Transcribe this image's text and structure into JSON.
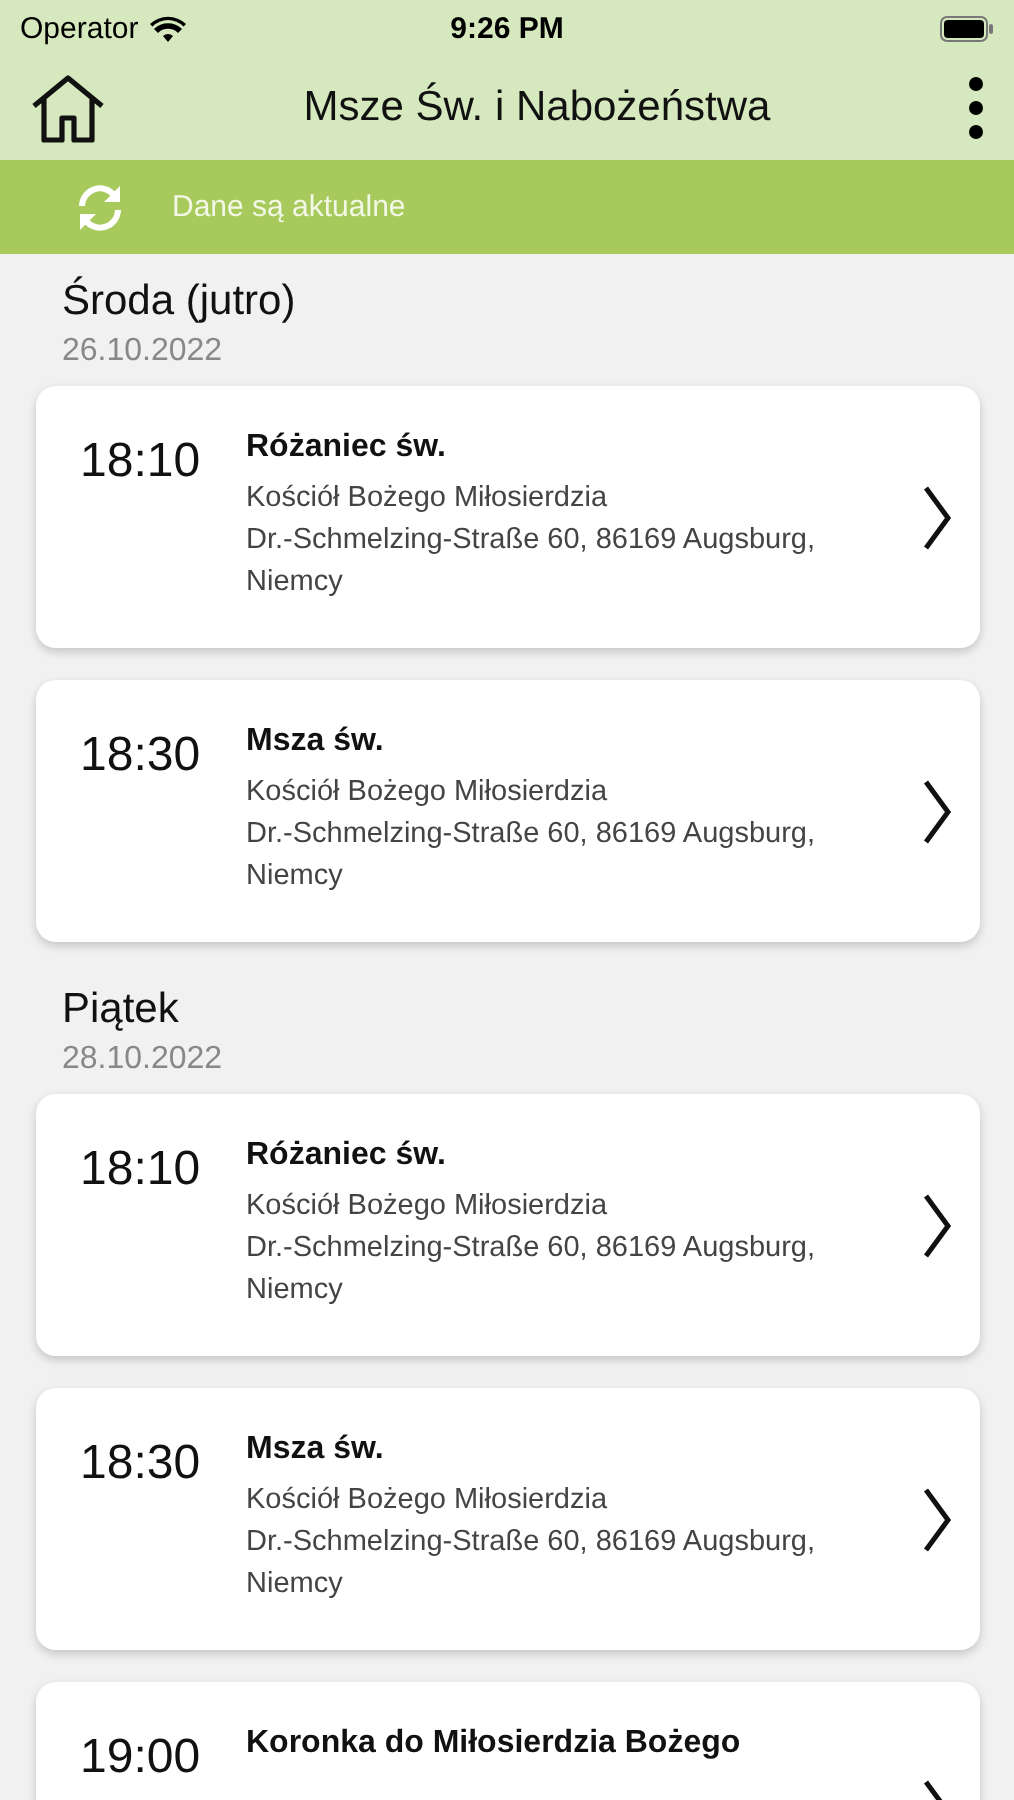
{
  "status_bar": {
    "carrier": "Operator",
    "time": "9:26 PM"
  },
  "header": {
    "title": "Msze Św. i Nabożeństwa"
  },
  "sync_bar": {
    "text": "Dane są aktualne"
  },
  "days": [
    {
      "day": "Środa (jutro)",
      "date": "26.10.2022",
      "events": [
        {
          "time": "18:10",
          "title": "Różaniec św.",
          "place": "Kościół Bożego Miłosierdzia",
          "address": "Dr.-Schmelzing-Straße 60, 86169 Augsburg, Niemcy"
        },
        {
          "time": "18:30",
          "title": "Msza św.",
          "place": "Kościół Bożego Miłosierdzia",
          "address": "Dr.-Schmelzing-Straße 60, 86169 Augsburg, Niemcy"
        }
      ]
    },
    {
      "day": "Piątek",
      "date": "28.10.2022",
      "events": [
        {
          "time": "18:10",
          "title": "Różaniec św.",
          "place": "Kościół Bożego Miłosierdzia",
          "address": "Dr.-Schmelzing-Straße 60, 86169 Augsburg, Niemcy"
        },
        {
          "time": "18:30",
          "title": "Msza św.",
          "place": "Kościół Bożego Miłosierdzia",
          "address": "Dr.-Schmelzing-Straße 60, 86169 Augsburg, Niemcy"
        },
        {
          "time": "19:00",
          "title": "Koronka do Miłosierdzia Bożego"
        }
      ]
    }
  ]
}
